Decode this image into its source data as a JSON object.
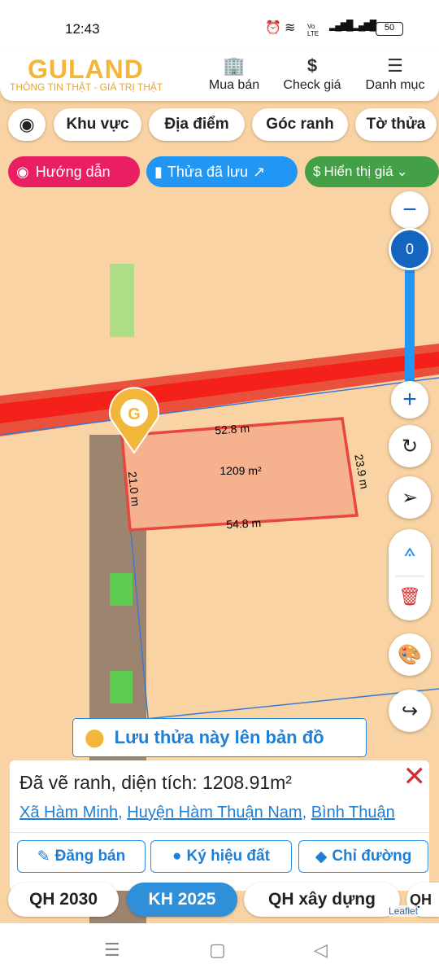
{
  "status": {
    "time": "12:43",
    "battery": "50",
    "network": "Vo LTE"
  },
  "header": {
    "logo": "GULAND",
    "slogan": "THÔNG TIN THẬT - GIÁ TRỊ THẬT",
    "nav": [
      {
        "label": "Mua bán",
        "icon": "building-icon"
      },
      {
        "label": "Check giá",
        "icon": "dollar-icon"
      },
      {
        "label": "Danh mục",
        "icon": "menu-icon"
      }
    ]
  },
  "filters": [
    "Khu vực",
    "Địa điểm",
    "Góc ranh",
    "Tờ thửa"
  ],
  "pills": [
    {
      "label": "Hướng dẫn",
      "color": "#e91e63"
    },
    {
      "label": "Thửa đã lưu",
      "color": "#2196f3"
    },
    {
      "label": "Hiển thị giá",
      "color": "#43a047"
    }
  ],
  "map": {
    "edges": [
      "52.8 m",
      "23.9 m",
      "54.8 m",
      "21.0 m"
    ],
    "area": "1209 m²",
    "zoom_value": "0",
    "attribution": "Leaflet"
  },
  "save_button": "Lưu thửa này lên bản đồ",
  "info": {
    "title": "Đã vẽ ranh, diện tích: 1208.91m²",
    "location": [
      "Xã Hàm Minh",
      "Huyện Hàm Thuận Nam",
      "Bình Thuận"
    ],
    "actions": [
      "Đăng bán",
      "Ký hiệu đất",
      "Chỉ đường"
    ]
  },
  "layers": [
    "QH 2030",
    "KH 2025",
    "QH xây dựng",
    "QH"
  ],
  "active_layer": "KH 2025",
  "colors": {
    "accent": "#2196f3",
    "active_tab": "#2f8fd8",
    "parcel_stroke": "#e8473f",
    "parcel_fill": "#f6b18f",
    "map_bg": "#f9d3a3"
  }
}
